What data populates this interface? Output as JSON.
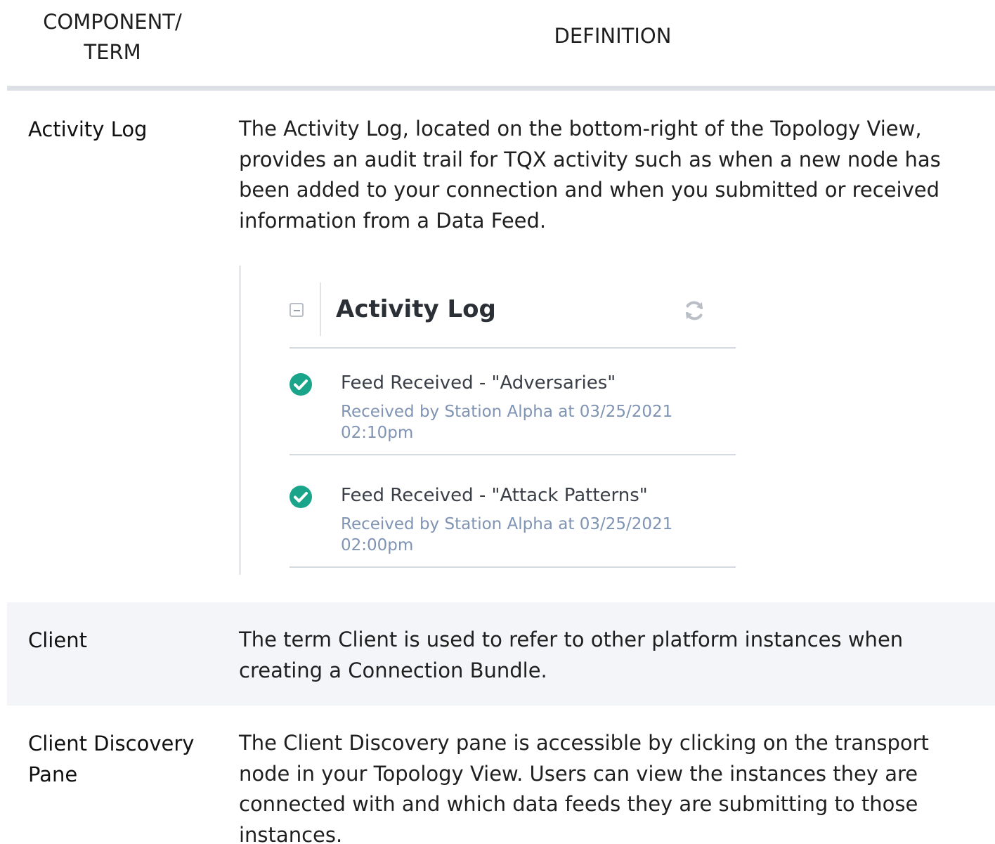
{
  "table": {
    "header": {
      "term": "COMPONENT/\nTERM",
      "definition": "DEFINITION"
    },
    "rows": [
      {
        "term": "Activity Log",
        "definition": "The Activity Log, located on the bottom-right of the Topology View, provides an audit trail for TQX activity such as when a new node has been added to your connection and when you submitted or received information from a Data Feed."
      },
      {
        "term": "Client",
        "definition": "The term Client is used to refer to other platform instances when creating a Connection Bundle."
      },
      {
        "term": "Client Discovery Pane",
        "definition": "The Client Discovery pane is accessible by clicking on the transport node in your Topology View.  Users can view the instances they are connected with and which data feeds they are submitting to those instances."
      }
    ]
  },
  "activity_log_widget": {
    "title": "Activity Log",
    "collapse_icon": "minus-square-icon",
    "refresh_icon": "refresh-icon",
    "entries": [
      {
        "icon": "check-circle-icon",
        "title": "Feed Received - \"Adversaries\"",
        "subtitle": "Received by Station Alpha at 03/25/2021 02:10pm"
      },
      {
        "icon": "check-circle-icon",
        "title": "Feed Received - \"Attack Patterns\"",
        "subtitle": "Received by Station Alpha at 03/25/2021 02:00pm"
      }
    ],
    "colors": {
      "success": "#1aa58a",
      "subtitle": "#7f93b3"
    }
  },
  "colors": {
    "row_shade": "#f3f5f8",
    "header_rule": "#dde1e7"
  }
}
